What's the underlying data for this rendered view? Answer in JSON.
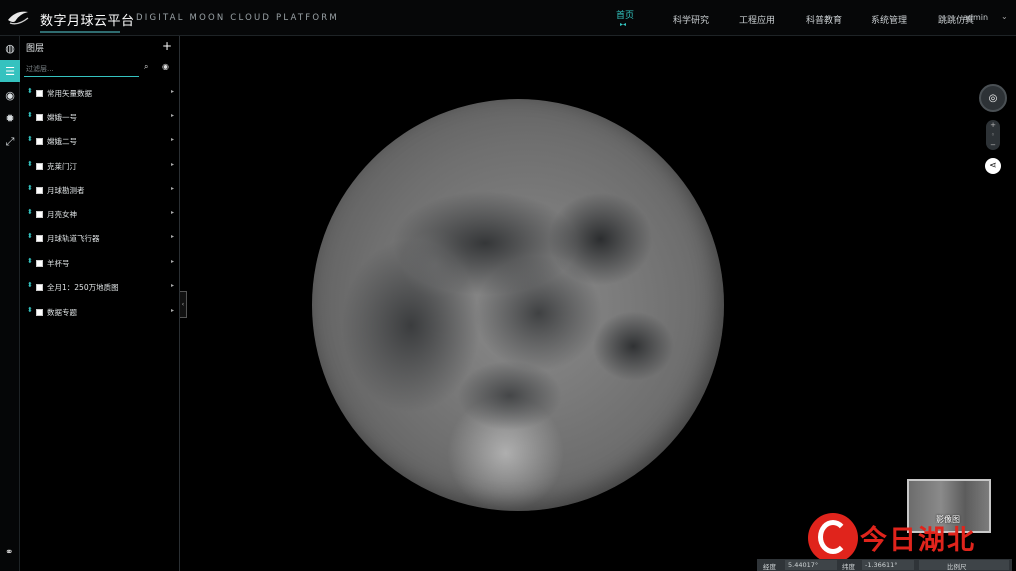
{
  "header": {
    "app_title": "数字月球云平台",
    "app_subtitle": "DIGITAL MOON CLOUD PLATFORM",
    "nav": [
      {
        "label": "首页",
        "active": true
      },
      {
        "label": "科学研究",
        "active": false
      },
      {
        "label": "工程应用",
        "active": false
      },
      {
        "label": "科普教育",
        "active": false
      },
      {
        "label": "系统管理",
        "active": false
      },
      {
        "label": "跳跳仿真",
        "active": false
      }
    ],
    "active_marker": "▸◂",
    "user": "admin",
    "user_caret": "⌄"
  },
  "rail": {
    "items": [
      {
        "icon": "globe-icon",
        "glyph": "◍"
      },
      {
        "icon": "list-icon",
        "glyph": "☰",
        "active": true
      },
      {
        "icon": "search-layer-icon",
        "glyph": "◉"
      },
      {
        "icon": "gear-icon",
        "glyph": "✹"
      },
      {
        "icon": "expand-icon",
        "glyph": "⤢"
      }
    ],
    "bottom_icon": "link-icon",
    "bottom_glyph": "⚭"
  },
  "layer_panel": {
    "title": "图层",
    "add_glyph": "+",
    "filter_placeholder": "过滤层...",
    "search_glyph": "⌕",
    "eye_glyph": "◉",
    "layers": [
      {
        "name": "常用矢量数据"
      },
      {
        "name": "嫦娥一号"
      },
      {
        "name": "嫦娥二号"
      },
      {
        "name": "克莱门汀"
      },
      {
        "name": "月球勘测者"
      },
      {
        "name": "月亮女神"
      },
      {
        "name": "月球轨道飞行器"
      },
      {
        "name": "羊杯号"
      },
      {
        "name": "全月1：250万地质图"
      },
      {
        "name": "数据专题"
      }
    ],
    "drag_glyph": "⬍",
    "arrow_glyph": "▸",
    "collapse_glyph": "‹"
  },
  "tools": {
    "compass_glyph": "◎",
    "zoom_in": "+",
    "zoom_reset": "◦",
    "zoom_out": "−",
    "share_glyph": "⋖"
  },
  "overview": {
    "label": "影像图"
  },
  "watermark": {
    "text": "今日湖北"
  },
  "status_bar": {
    "lon_label": "经度",
    "lon_value": "5.44017°",
    "lat_label": "纬度",
    "lat_value": "-1.36611°",
    "scale_label": "比例尺"
  }
}
